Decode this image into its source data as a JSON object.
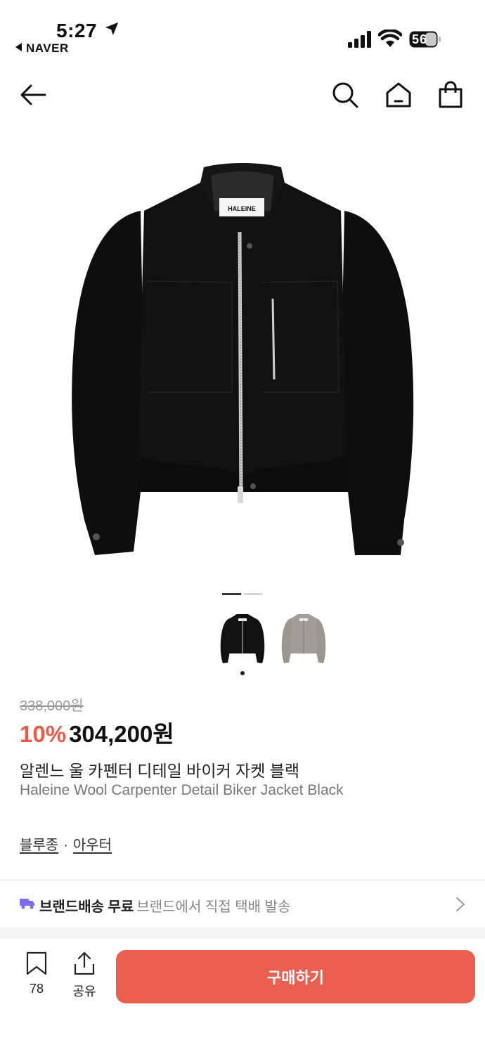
{
  "status": {
    "time": "5:27",
    "back_app": "NAVER",
    "battery": "56"
  },
  "nav": {
    "icons": [
      "back-arrow-icon",
      "search-icon",
      "home-icon",
      "shopping-bag-icon"
    ]
  },
  "gallery": {
    "brand_label": "HALEINE",
    "current_index": 1,
    "total": 2,
    "thumbnails": [
      "black-jacket",
      "gray-jacket"
    ]
  },
  "product": {
    "original_price": "338,000원",
    "discount": "10%",
    "sale_price": "304,200원",
    "name_ko": "알렌느 울 카펜터 디테일 바이커 자켓 블랙",
    "name_en": "Haleine Wool Carpenter Detail Biker Jacket Black",
    "categories": [
      "블루종",
      "아우터"
    ],
    "category_separator": "·"
  },
  "shipping": {
    "title": "브랜드배송 무료",
    "subtitle": "브랜드에서 직접 택배 발송"
  },
  "bottom_bar": {
    "bookmark_count": "78",
    "share_label": "공유",
    "buy_label": "구매하기"
  },
  "colors": {
    "accent": "#ea5f4f",
    "discount": "#e85c4a",
    "shipping_icon": "#7b6cf0"
  }
}
